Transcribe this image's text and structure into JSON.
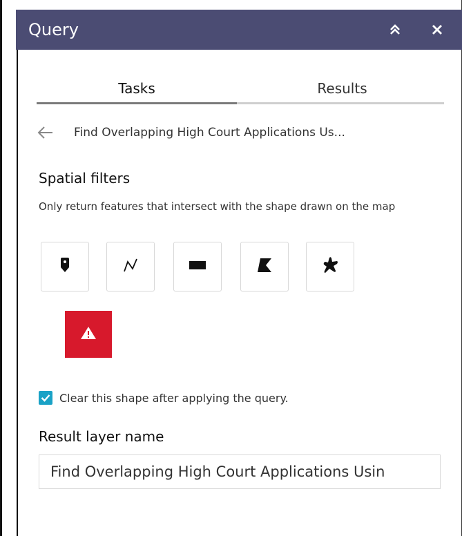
{
  "header": {
    "title": "Query",
    "bg_color": "#4b4c73",
    "collapse_icon": "double-chevron-up-icon",
    "close_icon": "close-icon"
  },
  "tabs": [
    {
      "label": "Tasks",
      "active": true
    },
    {
      "label": "Results",
      "active": false
    }
  ],
  "task": {
    "back_icon": "arrow-left-icon",
    "name": "Find Overlapping High Court Applications Us..."
  },
  "spatial": {
    "title": "Spatial filters",
    "description": "Only return features that intersect with the shape drawn on the map",
    "tools": [
      {
        "name": "point",
        "icon": "map-pin-icon"
      },
      {
        "name": "polyline",
        "icon": "polyline-icon"
      },
      {
        "name": "rectangle",
        "icon": "rectangle-icon"
      },
      {
        "name": "polygon",
        "icon": "polygon-icon"
      },
      {
        "name": "freehand-polygon",
        "icon": "freehand-polygon-icon"
      }
    ],
    "warning": {
      "icon": "warning-icon",
      "color": "#d7192c"
    }
  },
  "options": {
    "clear_shape_checked": true,
    "clear_shape_label": "Clear this shape after applying the query.",
    "checkbox_color": "#1aa2c6"
  },
  "result_layer": {
    "label": "Result layer name",
    "value": "Find Overlapping High Court Applications Usin"
  }
}
